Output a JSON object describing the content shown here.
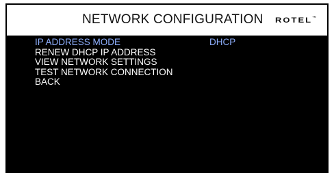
{
  "header": {
    "title": "NETWORK  CONFIGURATION",
    "brand": "ROTEL",
    "brand_mark": "™"
  },
  "menu": {
    "items": [
      {
        "label": "IP  ADDRESS  MODE",
        "value": "DHCP",
        "selected": true
      },
      {
        "label": "RENEW  DHCP  IP  ADDRESS"
      },
      {
        "label": "VIEW  NETWORK  SETTINGS"
      },
      {
        "label": "TEST  NETWORK  CONNECTION"
      },
      {
        "label": "BACK"
      }
    ]
  },
  "colors": {
    "background": "#000000",
    "title_bar": "#ffffff",
    "text": "#ffffff",
    "highlight": "#8fb0ff"
  }
}
